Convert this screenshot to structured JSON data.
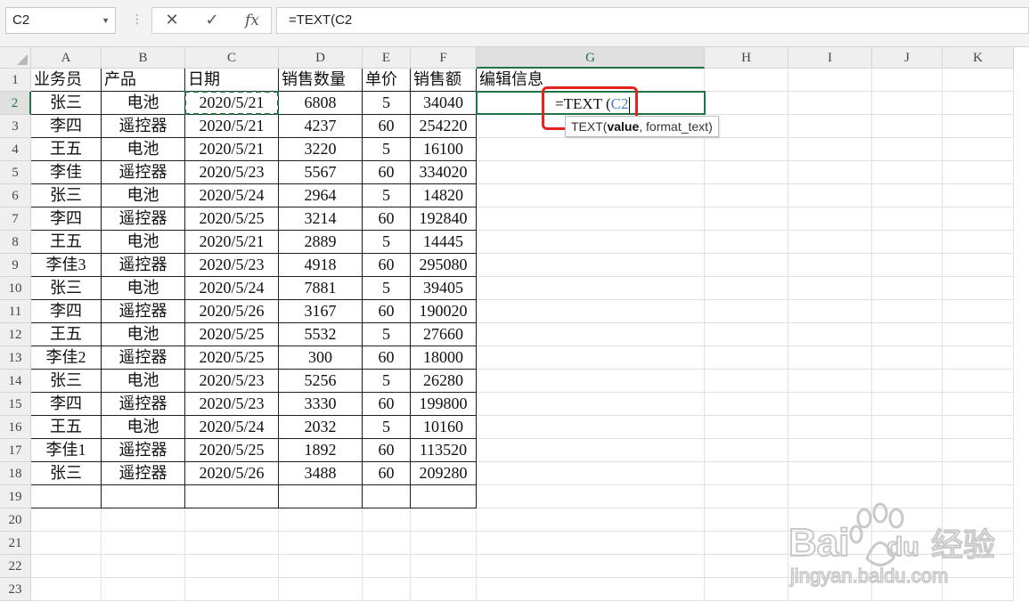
{
  "name_box": {
    "value": "C2"
  },
  "formula_bar": {
    "cancel_icon": "✕",
    "enter_icon": "✓",
    "fx_label": "fx",
    "value": "=TEXT(C2"
  },
  "columns": [
    "A",
    "B",
    "C",
    "D",
    "E",
    "F",
    "G",
    "H",
    "I",
    "J",
    "K"
  ],
  "rows": [
    "1",
    "2",
    "3",
    "4",
    "5",
    "6",
    "7",
    "8",
    "9",
    "10",
    "11",
    "12",
    "13",
    "14",
    "15",
    "16",
    "17",
    "18",
    "19",
    "20",
    "21",
    "22",
    "23"
  ],
  "headers": [
    "业务员",
    "产品",
    "日期",
    "销售数量",
    "单价",
    "销售额",
    "编辑信息"
  ],
  "table": [
    [
      "张三",
      "电池",
      "2020/5/21",
      "6808",
      "5",
      "34040"
    ],
    [
      "李四",
      "遥控器",
      "2020/5/21",
      "4237",
      "60",
      "254220"
    ],
    [
      "王五",
      "电池",
      "2020/5/21",
      "3220",
      "5",
      "16100"
    ],
    [
      "李佳",
      "遥控器",
      "2020/5/23",
      "5567",
      "60",
      "334020"
    ],
    [
      "张三",
      "电池",
      "2020/5/24",
      "2964",
      "5",
      "14820"
    ],
    [
      "李四",
      "遥控器",
      "2020/5/25",
      "3214",
      "60",
      "192840"
    ],
    [
      "王五",
      "电池",
      "2020/5/21",
      "2889",
      "5",
      "14445"
    ],
    [
      "李佳3",
      "遥控器",
      "2020/5/23",
      "4918",
      "60",
      "295080"
    ],
    [
      "张三",
      "电池",
      "2020/5/24",
      "7881",
      "5",
      "39405"
    ],
    [
      "李四",
      "遥控器",
      "2020/5/26",
      "3167",
      "60",
      "190020"
    ],
    [
      "王五",
      "电池",
      "2020/5/25",
      "5532",
      "5",
      "27660"
    ],
    [
      "李佳2",
      "遥控器",
      "2020/5/25",
      "300",
      "60",
      "18000"
    ],
    [
      "张三",
      "电池",
      "2020/5/23",
      "5256",
      "5",
      "26280"
    ],
    [
      "李四",
      "遥控器",
      "2020/5/23",
      "3330",
      "60",
      "199800"
    ],
    [
      "王五",
      "电池",
      "2020/5/24",
      "2032",
      "5",
      "10160"
    ],
    [
      "李佳1",
      "遥控器",
      "2020/5/25",
      "1892",
      "60",
      "113520"
    ],
    [
      "张三",
      "遥控器",
      "2020/5/26",
      "3488",
      "60",
      "209280"
    ]
  ],
  "editing": {
    "prefix": "=TEXT (",
    "ref": "C2"
  },
  "tooltip": {
    "func": "TEXT(",
    "arg1": "value",
    "rest": ", format_text)"
  },
  "watermark": {
    "brand": "Bai",
    "brand2": "du",
    "cn": "经验",
    "url": "jingyan.baidu.com"
  },
  "colors": {
    "accent": "#217346",
    "highlight": "#e5231e",
    "ref": "#4a7fc2"
  }
}
